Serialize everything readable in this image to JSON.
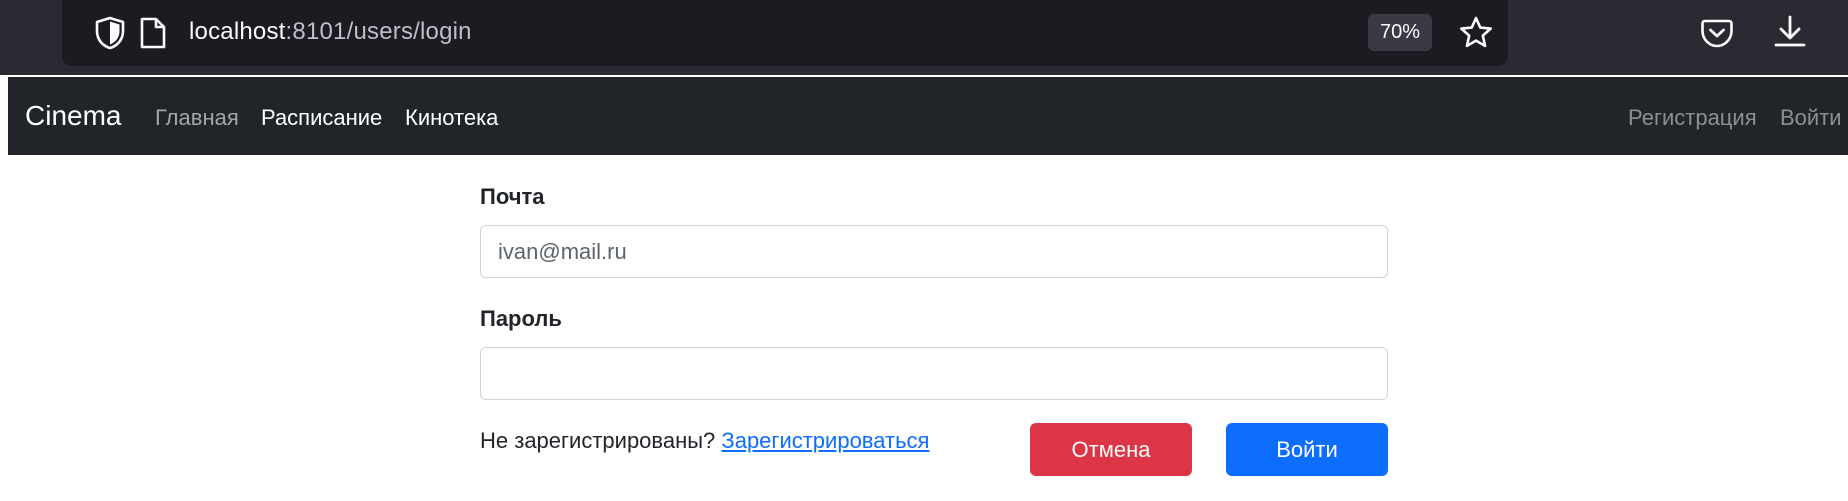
{
  "browser": {
    "url_host": "localhost",
    "url_rest": ":8101/users/login",
    "zoom": "70%"
  },
  "navbar": {
    "brand": "Cinema",
    "links": [
      "Главная",
      "Расписание",
      "Кинотека"
    ],
    "right_links": [
      "Регистрация",
      "Войти"
    ]
  },
  "form": {
    "email_label": "Почта",
    "email_placeholder": "ivan@mail.ru",
    "password_label": "Пароль",
    "password_value": "",
    "signup_prompt": "Не зарегистрированы?",
    "signup_link": "Зарегистрироваться",
    "cancel_button": "Отмена",
    "login_button": "Войти"
  },
  "colors": {
    "navbar_bg": "#212529",
    "cancel_bg": "#dc3545",
    "login_bg": "#0d6efd",
    "link": "#0d6efd"
  },
  "icons": [
    "shield-icon",
    "page-icon",
    "star-icon",
    "pocket-icon",
    "download-icon"
  ]
}
